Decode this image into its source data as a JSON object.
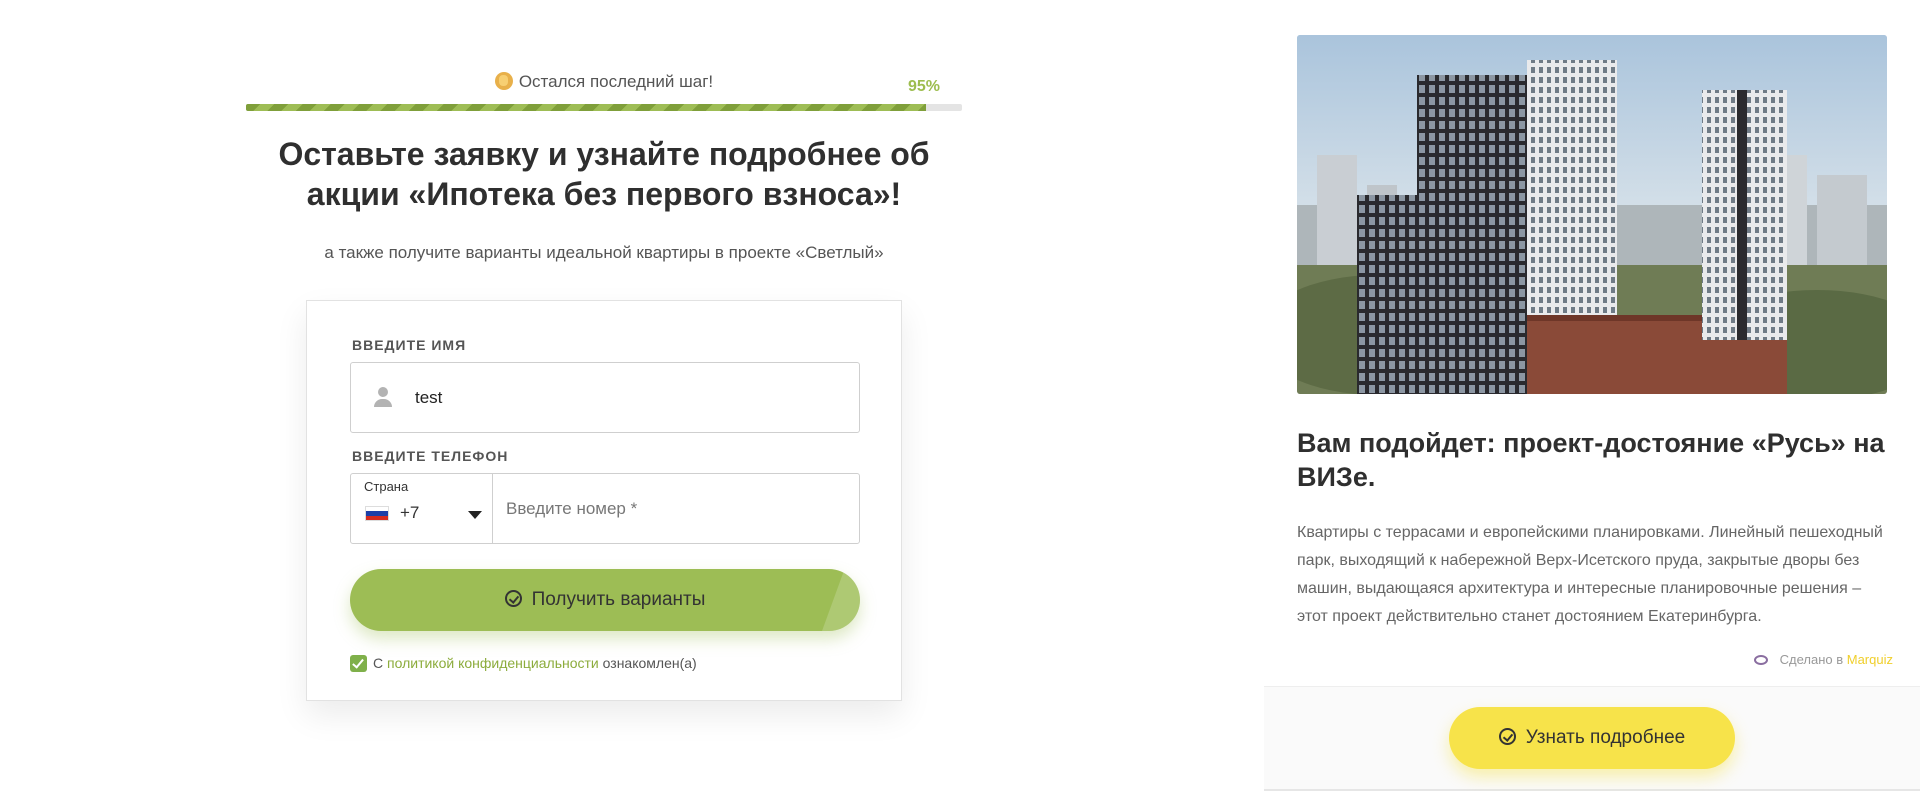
{
  "progress": {
    "label": "Остался последний шаг!",
    "percent_text": "95%",
    "value": 0.95
  },
  "headline": "Оставьте заявку и узнайте подробнее об акции «Ипотека без первого взноса»!",
  "subline": "а также получите варианты идеальной квартиры в проекте «Светлый»",
  "form": {
    "name_label": "Введите имя",
    "name_value": "test",
    "phone_label": "Введите телефон",
    "country_label": "Страна",
    "dial_code": "+7",
    "phone_placeholder": "Введите номер *",
    "submit_label": "Получить варианты",
    "consent_prefix": "С",
    "consent_link": "политикой конфиденциальности",
    "consent_suffix": "ознакомлен(а)",
    "consent_checked": true
  },
  "promo": {
    "title": "Вам подойдет: проект-достояние «Русь» на ВИЗе.",
    "description": "Квартиры с террасами и европейскими планировками. Линейный пешеходный парк, выходящий к набережной Верх-Исетского пруда, закрытые дворы без машин, выдающаяся архитектура и интересные планировочные решения – этот проект действительно станет достоянием Екатеринбурга.",
    "made_by_prefix": "Сделано в",
    "made_by_brand": "Marquiz",
    "more_label": "Узнать подробнее"
  },
  "colors": {
    "accent_green": "#9dbd55",
    "accent_yellow": "#f7e34a",
    "brand_yellow": "#f0cf2b"
  },
  "icons": {
    "progress": "hand-emoji-icon",
    "name_field": "user-icon",
    "submit": "check-circle-icon",
    "consent": "checkbox-icon",
    "made_by": "eye-icon",
    "more": "check-circle-icon"
  }
}
